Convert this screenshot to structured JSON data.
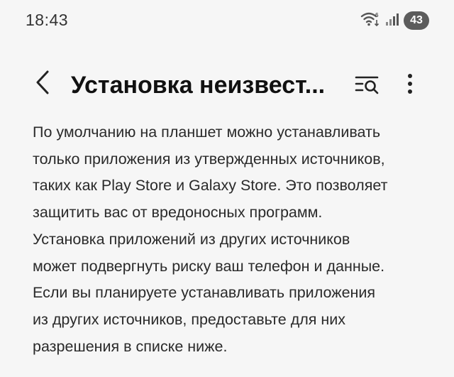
{
  "status_bar": {
    "time": "18:43",
    "wifi_icon": "wifi-icon",
    "signal_icon": "signal-icon",
    "battery_level": "43"
  },
  "app_bar": {
    "back_icon": "chevron-left-icon",
    "title": "Установка неизвест...",
    "search_icon": "search-list-icon",
    "more_icon": "more-vertical-icon"
  },
  "description": {
    "lines": [
      "По умолчанию на планшет можно устанавливать",
      "только приложения из утвержденных источников,",
      "таких как Play Store и Galaxy Store. Это позволяет",
      "защитить вас от вредоносных программ.",
      "Установка приложений из других источников",
      "может подвергнуть риску ваш телефон и данные.",
      "Если вы планируете устанавливать приложения",
      "из других источников, предоставьте для них",
      "разрешения в списке ниже."
    ]
  },
  "colors": {
    "background": "#f6f6f6",
    "text_primary": "#111111",
    "text_body": "#2a2a2a",
    "battery_badge": "#5c5c5c"
  }
}
